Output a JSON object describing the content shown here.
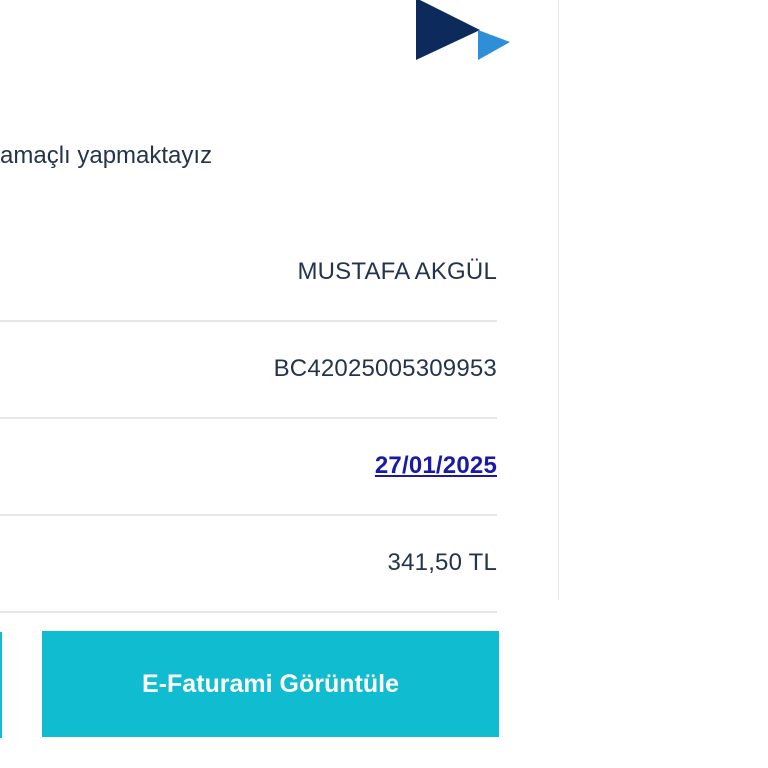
{
  "intro_text": "amaçlı yapmaktayız",
  "details": {
    "rows": [
      {
        "value": "MUSTAFA AKGÜL"
      },
      {
        "value": "BC42025005309953"
      },
      {
        "value": "27/01/2025"
      },
      {
        "value": "341,50 TL"
      }
    ]
  },
  "actions": {
    "view_einvoice_label": "E-Faturami Görüntüle"
  },
  "colors": {
    "accent": "#10bccf",
    "text": "#24344d",
    "link": "#1a1aa6",
    "logo_navy": "#0d2a5c",
    "logo_lime": "#c8dc1e",
    "logo_blue": "#2e8fd8"
  },
  "icons": {
    "logo": "brand-logo-icon"
  }
}
